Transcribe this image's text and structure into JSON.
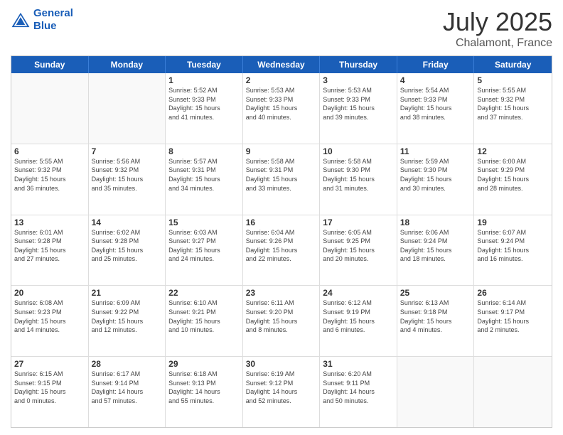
{
  "logo": {
    "line1": "General",
    "line2": "Blue"
  },
  "title": "July 2025",
  "subtitle": "Chalamont, France",
  "header_days": [
    "Sunday",
    "Monday",
    "Tuesday",
    "Wednesday",
    "Thursday",
    "Friday",
    "Saturday"
  ],
  "weeks": [
    [
      {
        "day": "",
        "info": ""
      },
      {
        "day": "",
        "info": ""
      },
      {
        "day": "1",
        "info": "Sunrise: 5:52 AM\nSunset: 9:33 PM\nDaylight: 15 hours\nand 41 minutes."
      },
      {
        "day": "2",
        "info": "Sunrise: 5:53 AM\nSunset: 9:33 PM\nDaylight: 15 hours\nand 40 minutes."
      },
      {
        "day": "3",
        "info": "Sunrise: 5:53 AM\nSunset: 9:33 PM\nDaylight: 15 hours\nand 39 minutes."
      },
      {
        "day": "4",
        "info": "Sunrise: 5:54 AM\nSunset: 9:33 PM\nDaylight: 15 hours\nand 38 minutes."
      },
      {
        "day": "5",
        "info": "Sunrise: 5:55 AM\nSunset: 9:32 PM\nDaylight: 15 hours\nand 37 minutes."
      }
    ],
    [
      {
        "day": "6",
        "info": "Sunrise: 5:55 AM\nSunset: 9:32 PM\nDaylight: 15 hours\nand 36 minutes."
      },
      {
        "day": "7",
        "info": "Sunrise: 5:56 AM\nSunset: 9:32 PM\nDaylight: 15 hours\nand 35 minutes."
      },
      {
        "day": "8",
        "info": "Sunrise: 5:57 AM\nSunset: 9:31 PM\nDaylight: 15 hours\nand 34 minutes."
      },
      {
        "day": "9",
        "info": "Sunrise: 5:58 AM\nSunset: 9:31 PM\nDaylight: 15 hours\nand 33 minutes."
      },
      {
        "day": "10",
        "info": "Sunrise: 5:58 AM\nSunset: 9:30 PM\nDaylight: 15 hours\nand 31 minutes."
      },
      {
        "day": "11",
        "info": "Sunrise: 5:59 AM\nSunset: 9:30 PM\nDaylight: 15 hours\nand 30 minutes."
      },
      {
        "day": "12",
        "info": "Sunrise: 6:00 AM\nSunset: 9:29 PM\nDaylight: 15 hours\nand 28 minutes."
      }
    ],
    [
      {
        "day": "13",
        "info": "Sunrise: 6:01 AM\nSunset: 9:28 PM\nDaylight: 15 hours\nand 27 minutes."
      },
      {
        "day": "14",
        "info": "Sunrise: 6:02 AM\nSunset: 9:28 PM\nDaylight: 15 hours\nand 25 minutes."
      },
      {
        "day": "15",
        "info": "Sunrise: 6:03 AM\nSunset: 9:27 PM\nDaylight: 15 hours\nand 24 minutes."
      },
      {
        "day": "16",
        "info": "Sunrise: 6:04 AM\nSunset: 9:26 PM\nDaylight: 15 hours\nand 22 minutes."
      },
      {
        "day": "17",
        "info": "Sunrise: 6:05 AM\nSunset: 9:25 PM\nDaylight: 15 hours\nand 20 minutes."
      },
      {
        "day": "18",
        "info": "Sunrise: 6:06 AM\nSunset: 9:24 PM\nDaylight: 15 hours\nand 18 minutes."
      },
      {
        "day": "19",
        "info": "Sunrise: 6:07 AM\nSunset: 9:24 PM\nDaylight: 15 hours\nand 16 minutes."
      }
    ],
    [
      {
        "day": "20",
        "info": "Sunrise: 6:08 AM\nSunset: 9:23 PM\nDaylight: 15 hours\nand 14 minutes."
      },
      {
        "day": "21",
        "info": "Sunrise: 6:09 AM\nSunset: 9:22 PM\nDaylight: 15 hours\nand 12 minutes."
      },
      {
        "day": "22",
        "info": "Sunrise: 6:10 AM\nSunset: 9:21 PM\nDaylight: 15 hours\nand 10 minutes."
      },
      {
        "day": "23",
        "info": "Sunrise: 6:11 AM\nSunset: 9:20 PM\nDaylight: 15 hours\nand 8 minutes."
      },
      {
        "day": "24",
        "info": "Sunrise: 6:12 AM\nSunset: 9:19 PM\nDaylight: 15 hours\nand 6 minutes."
      },
      {
        "day": "25",
        "info": "Sunrise: 6:13 AM\nSunset: 9:18 PM\nDaylight: 15 hours\nand 4 minutes."
      },
      {
        "day": "26",
        "info": "Sunrise: 6:14 AM\nSunset: 9:17 PM\nDaylight: 15 hours\nand 2 minutes."
      }
    ],
    [
      {
        "day": "27",
        "info": "Sunrise: 6:15 AM\nSunset: 9:15 PM\nDaylight: 15 hours\nand 0 minutes."
      },
      {
        "day": "28",
        "info": "Sunrise: 6:17 AM\nSunset: 9:14 PM\nDaylight: 14 hours\nand 57 minutes."
      },
      {
        "day": "29",
        "info": "Sunrise: 6:18 AM\nSunset: 9:13 PM\nDaylight: 14 hours\nand 55 minutes."
      },
      {
        "day": "30",
        "info": "Sunrise: 6:19 AM\nSunset: 9:12 PM\nDaylight: 14 hours\nand 52 minutes."
      },
      {
        "day": "31",
        "info": "Sunrise: 6:20 AM\nSunset: 9:11 PM\nDaylight: 14 hours\nand 50 minutes."
      },
      {
        "day": "",
        "info": ""
      },
      {
        "day": "",
        "info": ""
      }
    ]
  ]
}
